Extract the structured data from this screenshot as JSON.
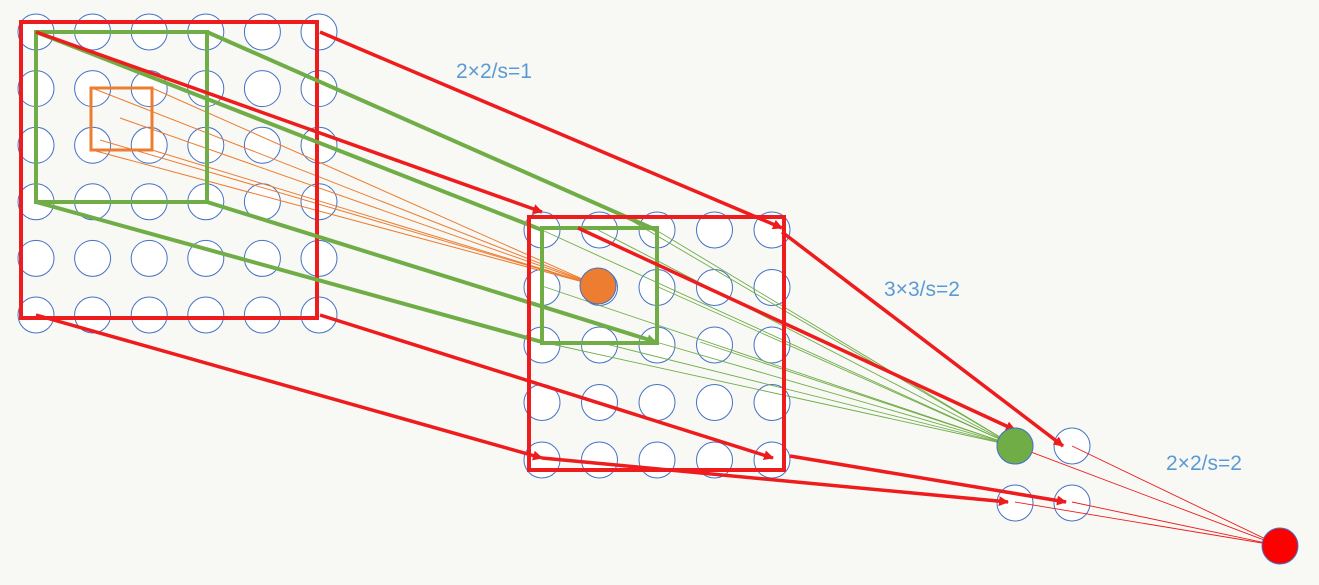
{
  "labels": {
    "layer1": "2×2/s=1",
    "layer2": "3×3/s=2",
    "layer3": "2×2/s=2"
  },
  "grids": {
    "input": {
      "rows": 6,
      "cols": 6
    },
    "middle": {
      "rows": 5,
      "cols": 5
    },
    "output_small": {
      "rows": 2,
      "cols": 2
    }
  },
  "colors": {
    "background": "#f8f8f5",
    "neuron_stroke": "#4472c4",
    "red": "#ee1c1c",
    "green": "#70ad47",
    "orange": "#ed7d31",
    "label": "#5b9bd5"
  }
}
